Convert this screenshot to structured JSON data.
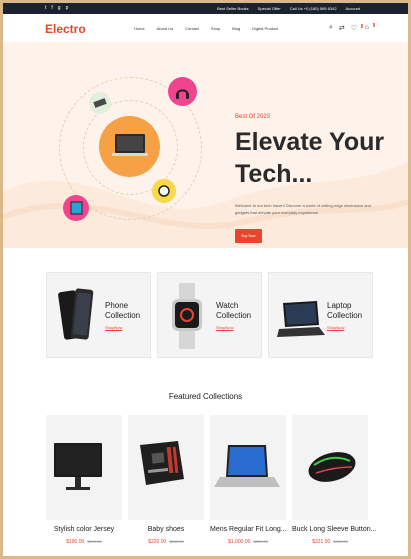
{
  "topbar": {
    "social_icons": [
      "twitter-icon",
      "facebook-icon",
      "google-plus-icon",
      "pinterest-icon"
    ],
    "social_glyphs": [
      "t",
      "f",
      "g",
      "p"
    ],
    "links": [
      "Best Seller Books",
      "Special Offer",
      "Call Us +0 (180) 565 6342",
      "Account"
    ]
  },
  "header": {
    "logo": "Electro",
    "nav": [
      "Home",
      "About Us",
      "Contact",
      "Shop",
      "Blog",
      "Digital Product"
    ],
    "icons": [
      "search-icon",
      "compare-icon",
      "wishlist-icon",
      "cart-icon"
    ],
    "wishlist_count": "0",
    "cart_count": "0"
  },
  "hero": {
    "kicker": "Best Of 2023",
    "title": "Elevate Your Tech...",
    "description": "Welcome to our tech haven! Discover a world of cutting-edge electronics and gadgets that elevate your everyday experience.",
    "button": "Buy Now"
  },
  "categories": [
    {
      "name": "Phone Collection",
      "link": "ShopNow"
    },
    {
      "name": "Watch Collection",
      "link": "ShopNow"
    },
    {
      "name": "Laptop Collection",
      "link": "ShopNow"
    }
  ],
  "featured": {
    "title": "Featured Collections",
    "products": [
      {
        "name": "Stylish color Jersey",
        "price": "$190.00",
        "old_price": "$250.00"
      },
      {
        "name": "Baby shoes",
        "price": "$220.00",
        "old_price": "$250.00"
      },
      {
        "name": "Mens Regular Fit Long...",
        "price": "$1,000.00",
        "old_price": "$800.00"
      },
      {
        "name": "Buck Long Sleeve Button...",
        "price": "$321.00",
        "old_price": "$450.00"
      }
    ]
  },
  "colors": {
    "accent": "#e8442e",
    "topbar": "#1d2230",
    "hero_bg": "#fdf3ea",
    "orange": "#f7a146",
    "pink": "#f0458e"
  }
}
